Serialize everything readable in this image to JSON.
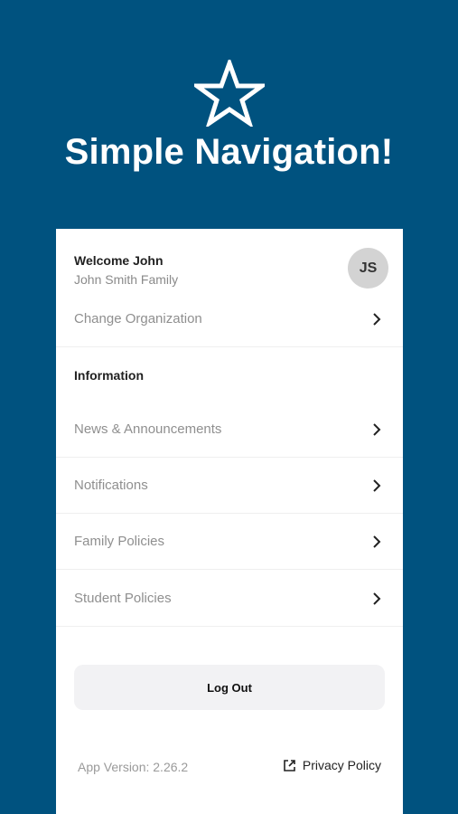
{
  "hero": {
    "title": "Simple Navigation!",
    "icon": "star-icon"
  },
  "user": {
    "welcome": "Welcome John",
    "family": "John Smith Family",
    "initials": "JS"
  },
  "change_org": {
    "label": "Change Organization"
  },
  "information": {
    "title": "Information",
    "items": [
      {
        "label": "News & Announcements"
      },
      {
        "label": "Notifications"
      },
      {
        "label": "Family Policies"
      },
      {
        "label": "Student Policies"
      }
    ]
  },
  "footer": {
    "logout_label": "Log Out",
    "version": "App Version: 2.26.2",
    "privacy_label": "Privacy Policy"
  },
  "colors": {
    "brand_blue": "#00527f",
    "panel_bg": "#ffffff",
    "avatar_bg": "#d3d3d3",
    "muted_text": "#8f8f8f"
  }
}
